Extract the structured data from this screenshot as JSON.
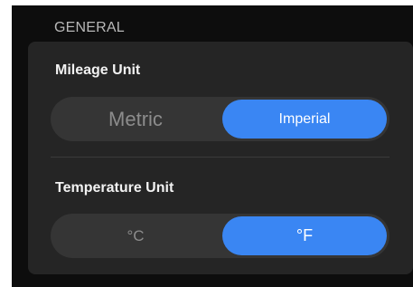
{
  "section": {
    "title": "GENERAL"
  },
  "mileage": {
    "label": "Mileage Unit",
    "options": [
      "Metric",
      "Imperial"
    ],
    "selected": "Imperial"
  },
  "temperature": {
    "label": "Temperature Unit",
    "options": [
      "°C",
      "°F"
    ],
    "selected": "°F"
  },
  "colors": {
    "background": "#0d0d0d",
    "card": "#252525",
    "track": "#353535",
    "accent": "#3a86f3"
  }
}
